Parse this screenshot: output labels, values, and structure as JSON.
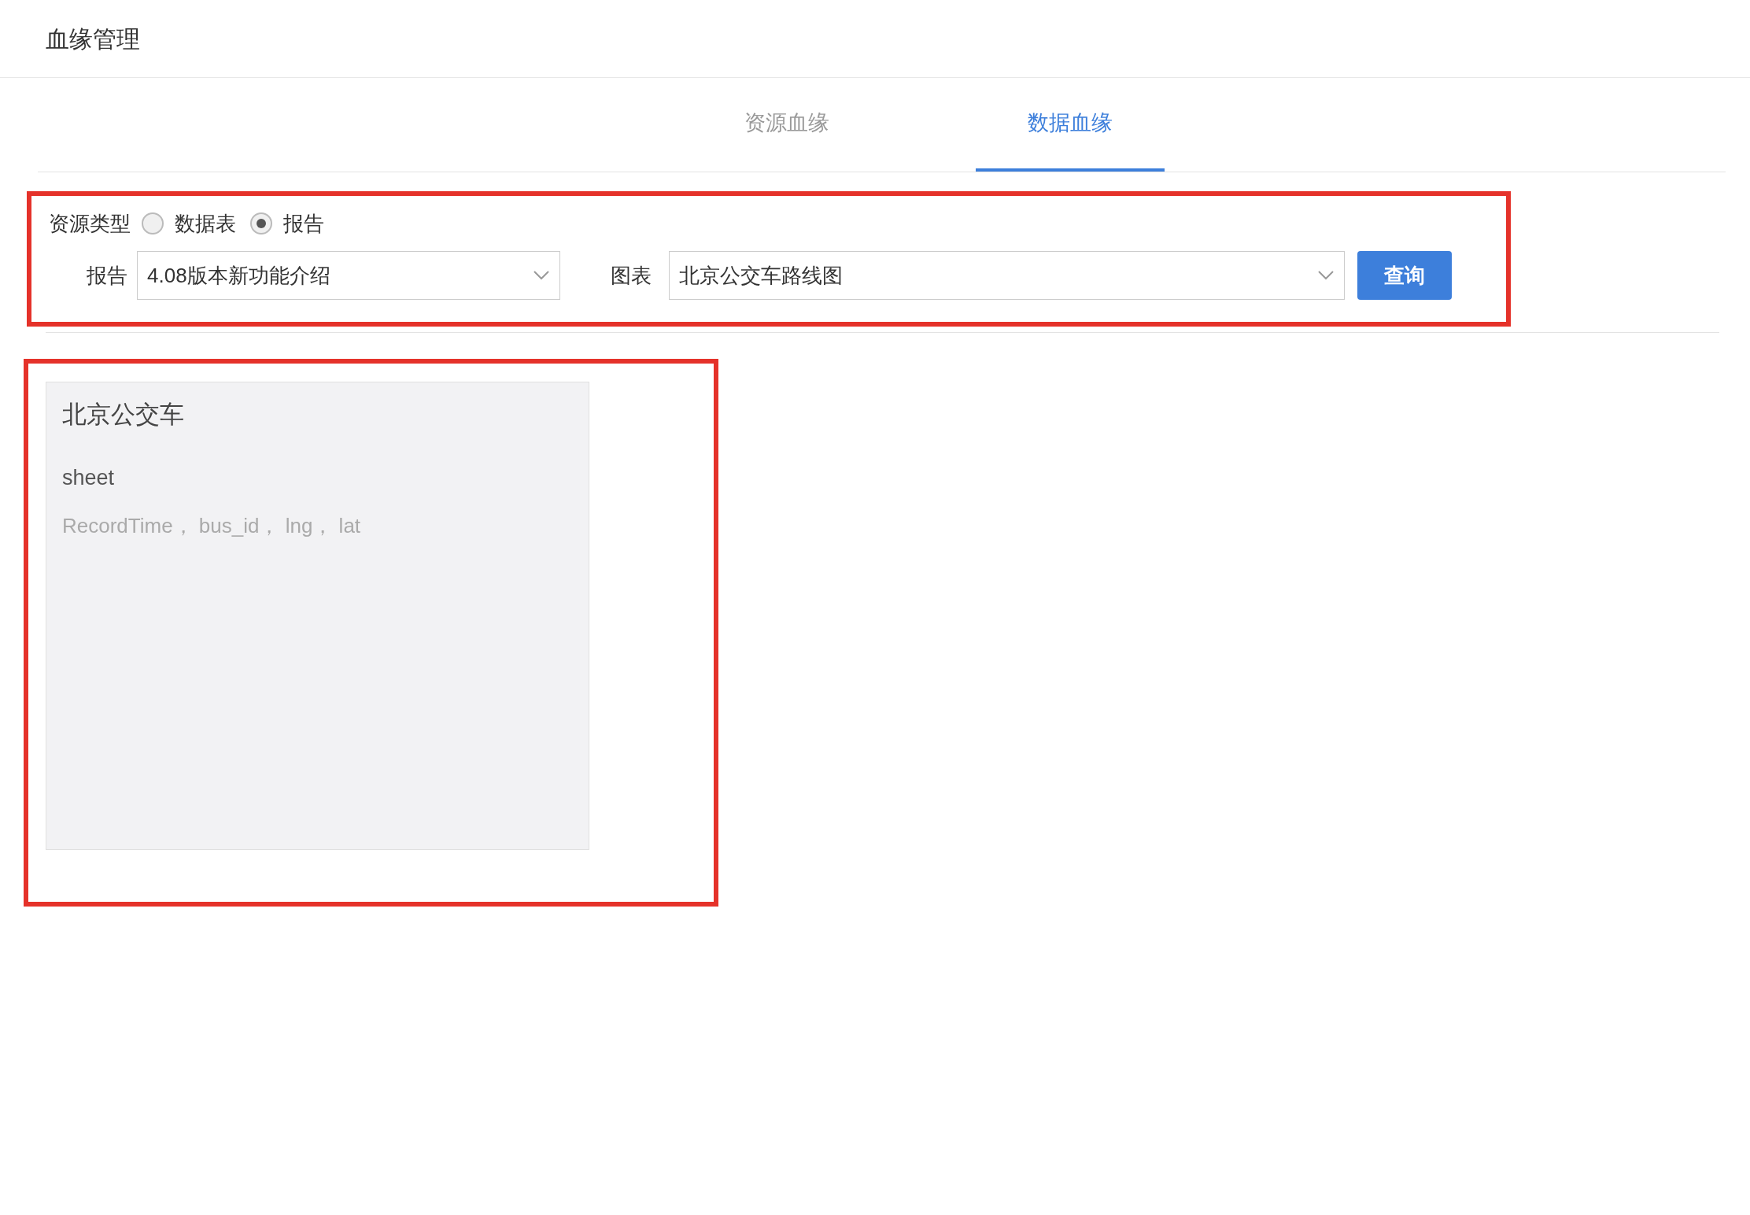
{
  "page": {
    "title": "血缘管理"
  },
  "tabs": [
    {
      "label": "资源血缘",
      "selected": false
    },
    {
      "label": "数据血缘",
      "selected": true
    }
  ],
  "filter": {
    "resource_type": {
      "label": "资源类型",
      "options": [
        {
          "label": "数据表",
          "selected": false
        },
        {
          "label": "报告",
          "selected": true
        }
      ]
    },
    "report": {
      "label": "报告",
      "value": "4.08版本新功能介绍"
    },
    "chart": {
      "label": "图表",
      "value": "北京公交车路线图"
    },
    "query_button": "查询"
  },
  "result_card": {
    "title": "北京公交车",
    "sheet": "sheet",
    "fields": "RecordTime， bus_id， lng， lat"
  }
}
